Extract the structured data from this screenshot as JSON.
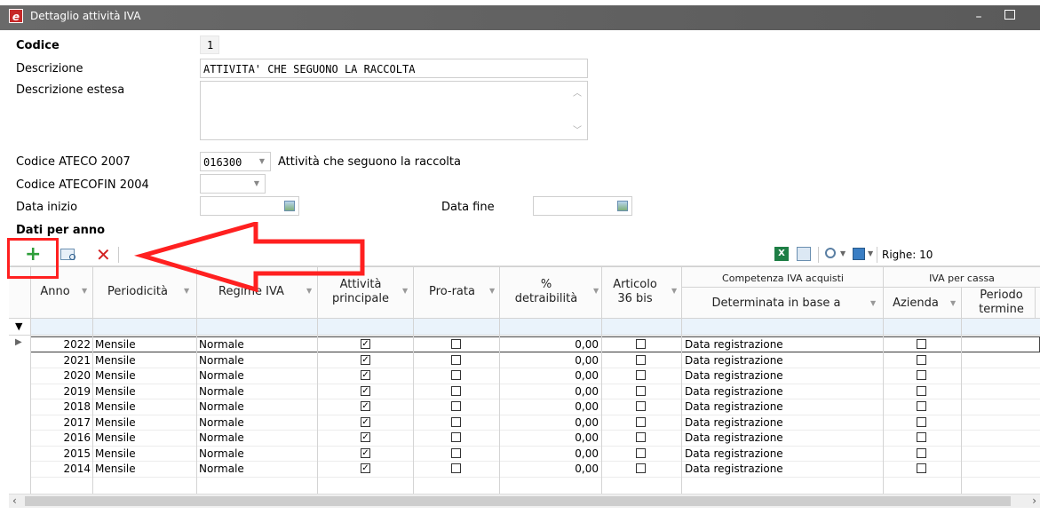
{
  "window": {
    "title": "Dettaglio attività IVA",
    "app_icon_letter": "e"
  },
  "form": {
    "codice_label": "Codice",
    "codice_value": "1",
    "descrizione_label": "Descrizione",
    "descrizione_value": "ATTIVITA' CHE SEGUONO LA RACCOLTA",
    "descrizione_estesa_label": "Descrizione estesa",
    "ateco2007_label": "Codice ATECO 2007",
    "ateco2007_value": "016300",
    "ateco2007_desc": "Attività che seguono la raccolta",
    "atecofin_label": "Codice ATECOFIN 2004",
    "data_inizio_label": "Data inizio",
    "data_fine_label": "Data fine"
  },
  "section": {
    "title": "Dati per anno"
  },
  "toolbar": {
    "add_symbol": "+",
    "delete_symbol": "✕",
    "rows_label": "Righe: 10"
  },
  "grid": {
    "group_headers": {
      "competenza": "Competenza IVA acquisti",
      "iva_cassa": "IVA per cassa"
    },
    "headers": {
      "anno": "Anno",
      "periodicita": "Periodicità",
      "regime": "Regime IVA",
      "attivita_1": "Attività",
      "attivita_2": "principale",
      "prorata": "Pro-rata",
      "perc_1": "%",
      "perc_2": "detraibilità",
      "art_1": "Articolo",
      "art_2": "36 bis",
      "determinata": "Determinata in base a",
      "azienda": "Azienda",
      "periodo_1": "Periodo",
      "periodo_2": "termine"
    },
    "rows": [
      {
        "anno": "2022",
        "periodicita": "Mensile",
        "regime": "Normale",
        "principale": true,
        "prorata": false,
        "detraibilita": "0,00",
        "art36": false,
        "determinata": "Data registrazione",
        "azienda": false
      },
      {
        "anno": "2021",
        "periodicita": "Mensile",
        "regime": "Normale",
        "principale": true,
        "prorata": false,
        "detraibilita": "0,00",
        "art36": false,
        "determinata": "Data registrazione",
        "azienda": false
      },
      {
        "anno": "2020",
        "periodicita": "Mensile",
        "regime": "Normale",
        "principale": true,
        "prorata": false,
        "detraibilita": "0,00",
        "art36": false,
        "determinata": "Data registrazione",
        "azienda": false
      },
      {
        "anno": "2019",
        "periodicita": "Mensile",
        "regime": "Normale",
        "principale": true,
        "prorata": false,
        "detraibilita": "0,00",
        "art36": false,
        "determinata": "Data registrazione",
        "azienda": false
      },
      {
        "anno": "2018",
        "periodicita": "Mensile",
        "regime": "Normale",
        "principale": true,
        "prorata": false,
        "detraibilita": "0,00",
        "art36": false,
        "determinata": "Data registrazione",
        "azienda": false
      },
      {
        "anno": "2017",
        "periodicita": "Mensile",
        "regime": "Normale",
        "principale": true,
        "prorata": false,
        "detraibilita": "0,00",
        "art36": false,
        "determinata": "Data registrazione",
        "azienda": false
      },
      {
        "anno": "2016",
        "periodicita": "Mensile",
        "regime": "Normale",
        "principale": true,
        "prorata": false,
        "detraibilita": "0,00",
        "art36": false,
        "determinata": "Data registrazione",
        "azienda": false
      },
      {
        "anno": "2015",
        "periodicita": "Mensile",
        "regime": "Normale",
        "principale": true,
        "prorata": false,
        "detraibilita": "0,00",
        "art36": false,
        "determinata": "Data registrazione",
        "azienda": false
      },
      {
        "anno": "2014",
        "periodicita": "Mensile",
        "regime": "Normale",
        "principale": true,
        "prorata": false,
        "detraibilita": "0,00",
        "art36": false,
        "determinata": "Data registrazione",
        "azienda": false
      }
    ]
  },
  "colors": {
    "annotation_red": "#ff2020",
    "add_green": "#2e9e3a",
    "delete_red": "#d32020",
    "titlebar": "#5e5e5e"
  }
}
